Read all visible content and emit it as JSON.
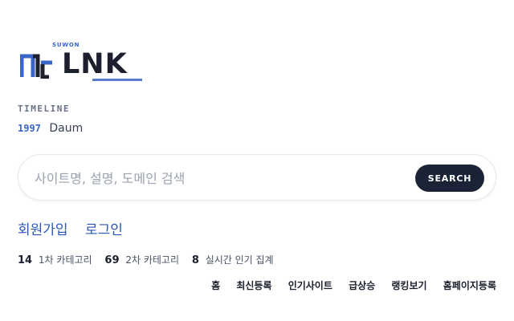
{
  "logo": {
    "tagline": "SUWON",
    "text": "LNK",
    "accent_color": "#3a64c8",
    "mark_icon": "bracket-logo-icon"
  },
  "timeline": {
    "label": "TIMELINE",
    "year": "1997",
    "event": "Daum"
  },
  "search": {
    "placeholder": "사이트명, 설명, 도메인 검색",
    "value": "",
    "button_label": "SEARCH"
  },
  "auth": {
    "signup": "회원가입",
    "login": "로그인"
  },
  "stats": [
    {
      "count": "14",
      "label": "1차 카테고리"
    },
    {
      "count": "69",
      "label": "2차 카테고리"
    },
    {
      "count": "8",
      "label": "실시간 인기 집계"
    }
  ],
  "nav": [
    "홈",
    "최신등록",
    "인기사이트",
    "급상승",
    "랭킹보기",
    "홈페이지등록"
  ]
}
